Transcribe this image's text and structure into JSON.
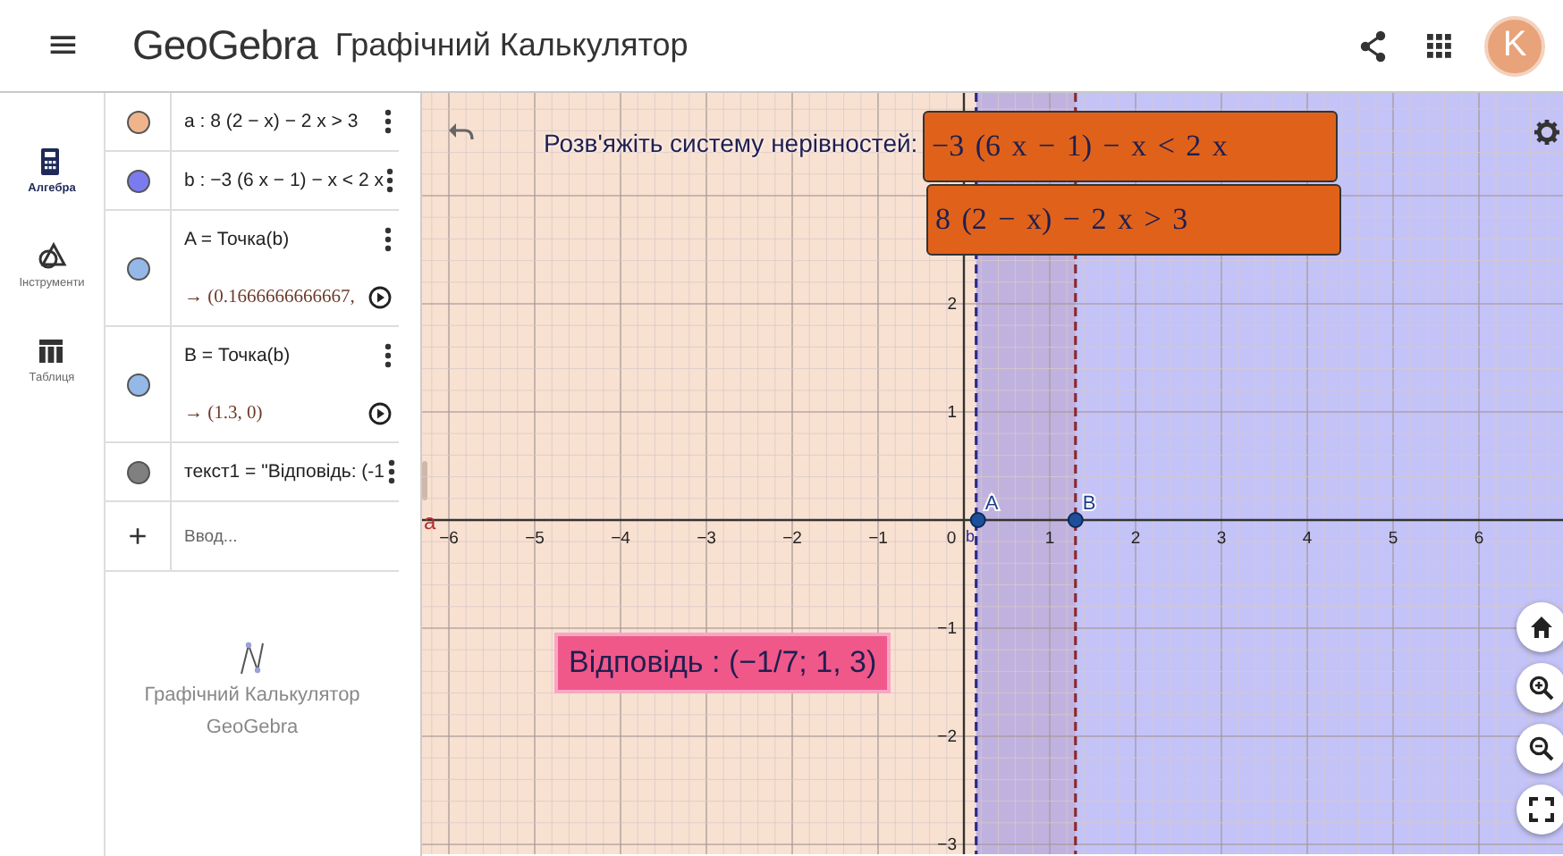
{
  "header": {
    "menu_icon": "≡",
    "logo": "GeoGebra",
    "title": "Графічний Калькулятор",
    "avatar_letter": "K"
  },
  "rail": [
    {
      "kind": "algebra",
      "label": "Алгебра",
      "selected": true
    },
    {
      "kind": "tools",
      "label": "Інструменти",
      "selected": false
    },
    {
      "kind": "table",
      "label": "Таблиця",
      "selected": false
    }
  ],
  "algebra": [
    {
      "kind": "expression",
      "color": "#f0b48c",
      "definition": "a : 8 (2 − x) − 2 x > 3"
    },
    {
      "kind": "expression",
      "color": "#7b7bf0",
      "definition": "b : −3 (6 x − 1) − x < 2 x"
    },
    {
      "kind": "point",
      "color": "#94b8e8",
      "definition": "A = Точка(b)",
      "output": "→ (0.1666666666667,"
    },
    {
      "kind": "point",
      "color": "#94b8e8",
      "definition": "B = Точка(b)",
      "output": "→ (1.3, 0)"
    },
    {
      "kind": "expression",
      "color": "#808080",
      "definition": "текст1 = \"Відповідь: (-1"
    }
  ],
  "input": {
    "plus": "+",
    "placeholder": "Ввод..."
  },
  "algebra_footer": {
    "line1": "Графічний Калькулятор",
    "line2": "GeoGebra"
  },
  "graphics": {
    "task_label": "Розв'яжіть систему нерівностей:",
    "inequalities": [
      "−3 (6 x − 1) − x < 2 x",
      "8 (2 − x) − 2 x > 3"
    ],
    "answer": "Відповідь : (−1/7; 1, 3)",
    "x_ticks": [
      "−6",
      "−5",
      "−4",
      "−3",
      "−2",
      "−1",
      "0",
      "1",
      "2",
      "3",
      "4",
      "5",
      "6"
    ],
    "y_ticks": [
      "2",
      "1",
      "−1",
      "−2",
      "−3"
    ],
    "points": [
      {
        "label": "A"
      },
      {
        "label": "B"
      }
    ],
    "curve_labels": [
      "a",
      "b"
    ]
  }
}
